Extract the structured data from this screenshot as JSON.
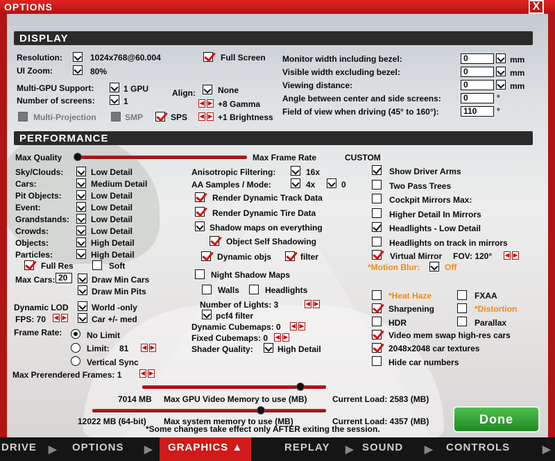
{
  "window": {
    "title": "OPTIONS",
    "close": "X"
  },
  "display": {
    "header": "DISPLAY",
    "resolution_label": "Resolution:",
    "resolution": "1024x768@60.004",
    "uizoom_label": "UI Zoom:",
    "uizoom": "80%",
    "multigpu_label": "Multi-GPU Support:",
    "multigpu": "1 GPU",
    "screens_label": "Number of screens:",
    "screens": "1",
    "fullscreen": "Full Screen",
    "align_label": "Align:",
    "align": "None",
    "gamma": "+8 Gamma",
    "brightness": "+1 Brightness",
    "multiproj": "Multi-Projection",
    "smp": "SMP",
    "sps": "SPS",
    "monitor_width_label": "Monitor width including bezel:",
    "monitor_width": "0",
    "visible_width_label": "Visible width excluding bezel:",
    "visible_width": "0",
    "viewing_dist_label": "Viewing distance:",
    "viewing_dist": "0",
    "angle_label": "Angle between center and side screens:",
    "angle": "0",
    "fov_label": "Field of view when driving (45° to 160°):",
    "fov": "110",
    "unit_mm": "mm",
    "unit_deg": "°"
  },
  "perf": {
    "header": "PERFORMANCE",
    "maxq": "Max Quality",
    "maxfr": "Max Frame Rate",
    "custom": "CUSTOM",
    "rows": [
      {
        "label": "Sky/Clouds:",
        "value": "Low Detail"
      },
      {
        "label": "Cars:",
        "value": "Medium Detail"
      },
      {
        "label": "Pit Objects:",
        "value": "Low Detail"
      },
      {
        "label": "Event:",
        "value": "Low Detail"
      },
      {
        "label": "Grandstands:",
        "value": "Low Detail"
      },
      {
        "label": "Crowds:",
        "value": "Low Detail"
      },
      {
        "label": "Objects:",
        "value": "High Detail"
      },
      {
        "label": "Particles:",
        "value": "High Detail"
      }
    ],
    "fullres": "Full Res",
    "soft": "Soft",
    "maxcars_label": "Max Cars:",
    "maxcars": "20",
    "drawmincars": "Draw Min Cars",
    "drawminpits": "Draw Min Pits",
    "dynlod_label": "Dynamic LOD",
    "dynlod": "World -only",
    "fps_label": "FPS: 70",
    "carmed": "Car +/- med",
    "framerate_label": "Frame Rate:",
    "nolimit": "No Limit",
    "limit_label": "Limit:",
    "limit": "81",
    "vsync": "Vertical Sync",
    "prerender": "Max Prerendered Frames: 1",
    "aniso_label": "Anisotropic Filtering:",
    "aniso": "16x",
    "aa_label": "AA Samples / Mode:",
    "aa": "4x",
    "aa_mode": "0",
    "rdtrack": "Render Dynamic Track Data",
    "rdtire": "Render Dynamic Tire Data",
    "shadowall": "Shadow maps on everything",
    "selfshadow": "Object Self Shadowing",
    "dynobjs": "Dynamic objs",
    "filter": "filter",
    "nightshadow": "Night Shadow Maps",
    "walls": "Walls",
    "headlights": "Headlights",
    "lights_label": "Number of Lights: 3",
    "pcf4": "pcf4 filter",
    "dyncube": "Dynamic Cubemaps: 0",
    "fixcube": "Fixed Cubemaps: 0",
    "shader_label": "Shader Quality:",
    "shader": "High Detail",
    "gpu_mem": "7014 MB",
    "gpu_mem_label": "Max GPU Video Memory to use (MB)",
    "gpu_load": "Current Load: 2583 (MB)",
    "sys_mem": "12022 MB (64-bit)",
    "sys_mem_label": "Max system memory to use (MB)",
    "sys_load": "Current Load: 4357 (MB)",
    "note": "*Some changes take effect only AFTER exiting the session.",
    "maxq_level": 0.0,
    "gpu_level": 0.86,
    "sys_level": 0.72,
    "right": [
      {
        "label": "Show Driver Arms",
        "checked": true
      },
      {
        "label": "Two Pass Trees",
        "checked": false
      },
      {
        "label": "Cockpit Mirrors  Max:",
        "checked": false
      },
      {
        "label": "Higher Detail In Mirrors",
        "checked": false
      },
      {
        "label": "Headlights - Low Detail",
        "checked": true
      },
      {
        "label": "Headlights on track in mirrors",
        "checked": false
      }
    ],
    "vmirror": "Virtual Mirror",
    "vmirror_fov": "FOV:  120°",
    "motionblur": "*Motion Blur:",
    "motionblur_val": "Off",
    "heathaze": "*Heat Haze",
    "fxaa": "FXAA",
    "sharpening": "Sharpening",
    "distortion": "*Distortion",
    "hdr": "HDR",
    "parallax": "Parallax",
    "vidswap": "Video mem swap high-res cars",
    "tex2048": "2048x2048 car textures",
    "hidenum": "Hide car numbers"
  },
  "done": "Done",
  "tabs": {
    "drive": "DRIVE",
    "options": "OPTIONS",
    "graphics": "GRAPHICS ▲",
    "replay": "REPLAY",
    "sound": "SOUND",
    "controls": "CONTROLS"
  }
}
